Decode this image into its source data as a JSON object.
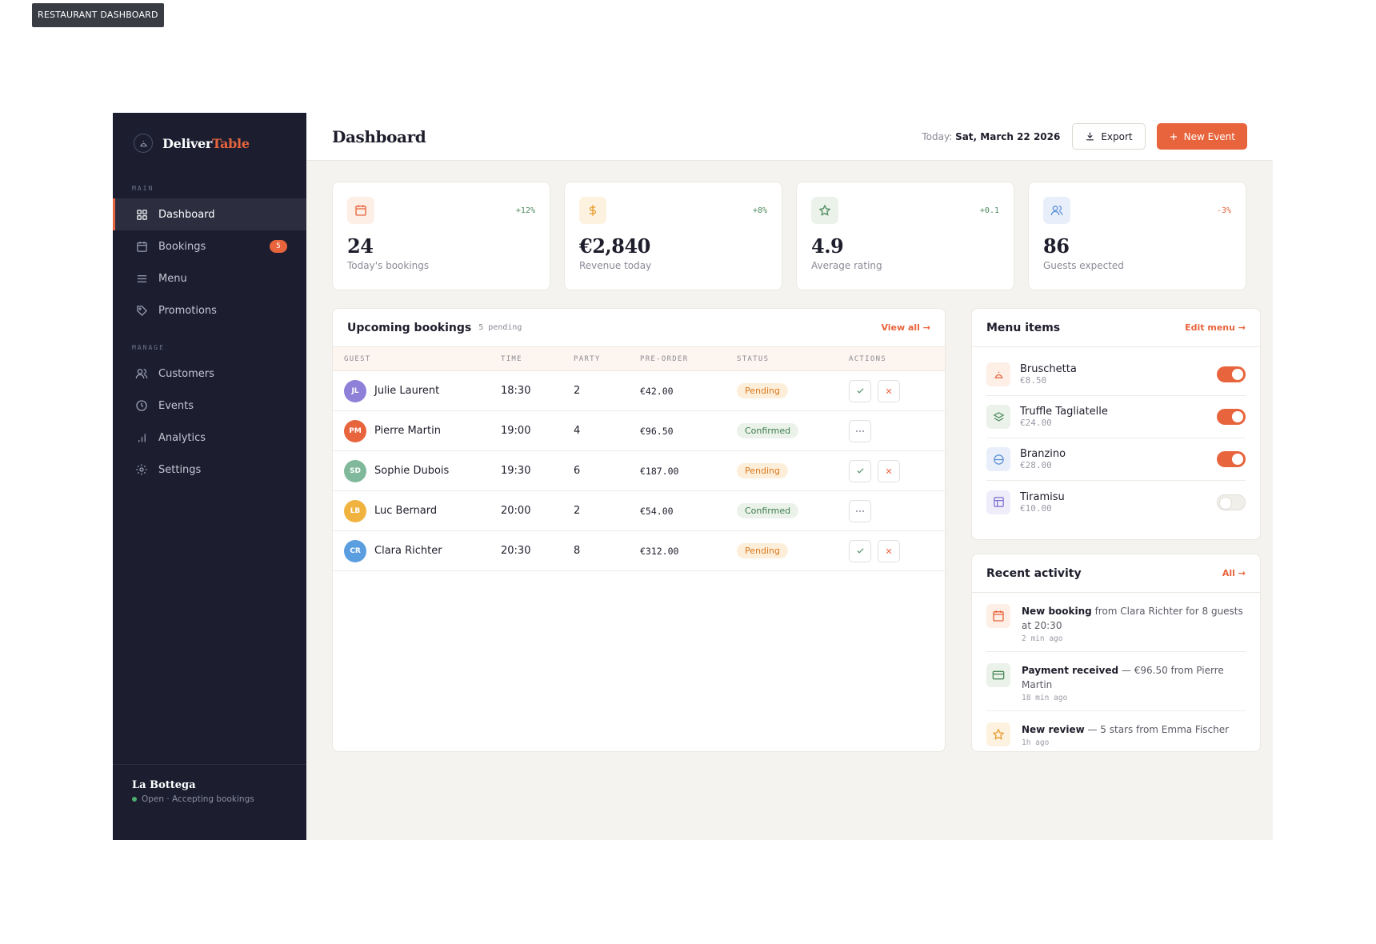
{
  "top_tag": "RESTAURANT DASHBOARD",
  "brand": {
    "name_a": "Deliver",
    "name_b": "Table"
  },
  "sidebar": {
    "section_main": "MAIN",
    "section_manage": "MANAGE",
    "items": [
      {
        "label": "Dashboard",
        "icon": "grid-icon"
      },
      {
        "label": "Bookings",
        "icon": "calendar-icon",
        "badge": "5"
      },
      {
        "label": "Menu",
        "icon": "menu-lines-icon"
      },
      {
        "label": "Promotions",
        "icon": "tag-icon"
      },
      {
        "label": "Customers",
        "icon": "users-icon"
      },
      {
        "label": "Events",
        "icon": "clock-icon"
      },
      {
        "label": "Analytics",
        "icon": "bar-chart-icon"
      },
      {
        "label": "Settings",
        "icon": "settings-icon"
      }
    ],
    "footer": {
      "name": "La Bottega",
      "status": "Open · Accepting bookings"
    }
  },
  "header": {
    "title": "Dashboard",
    "today_label": "Today:",
    "today_date": "Sat, March 22 2026",
    "export_label": "Export",
    "new_event_label": "New Event"
  },
  "stats": [
    {
      "value": "24",
      "label": "Today's bookings",
      "delta": "+12%",
      "icon": "calendar-icon",
      "color": "#e8643c",
      "bg": "#fdeee6"
    },
    {
      "value": "€2,840",
      "label": "Revenue today",
      "delta": "+8%",
      "icon": "dollar-icon",
      "color": "#e89a2c",
      "bg": "#fdf2df"
    },
    {
      "value": "4.9",
      "label": "Average rating",
      "delta": "+0.1",
      "icon": "star-icon",
      "color": "#4d8a5c",
      "bg": "#eaf2ea"
    },
    {
      "value": "86",
      "label": "Guests expected",
      "delta": "-3%",
      "icon": "users-icon",
      "color": "#5b8fd6",
      "bg": "#e8effa"
    }
  ],
  "bookings": {
    "title": "Upcoming bookings",
    "sub": "5 pending",
    "view_all": "View all →",
    "columns": [
      "GUEST",
      "TIME",
      "PARTY",
      "PRE-ORDER",
      "STATUS",
      "ACTIONS"
    ],
    "rows": [
      {
        "initials": "JL",
        "name": "Julie Laurent",
        "time": "18:30",
        "party": "2",
        "preorder": "€42.00",
        "status": "Pending",
        "avatar": "#8e7fd8"
      },
      {
        "initials": "PM",
        "name": "Pierre Martin",
        "time": "19:00",
        "party": "4",
        "preorder": "€96.50",
        "status": "Confirmed",
        "avatar": "#e8643c"
      },
      {
        "initials": "SD",
        "name": "Sophie Dubois",
        "time": "19:30",
        "party": "6",
        "preorder": "€187.00",
        "status": "Pending",
        "avatar": "#7fb89a"
      },
      {
        "initials": "LB",
        "name": "Luc Bernard",
        "time": "20:00",
        "party": "2",
        "preorder": "€54.00",
        "status": "Confirmed",
        "avatar": "#f0b340"
      },
      {
        "initials": "CR",
        "name": "Clara Richter",
        "time": "20:30",
        "party": "8",
        "preorder": "€312.00",
        "status": "Pending",
        "avatar": "#5b9ee0"
      }
    ]
  },
  "menu_items": {
    "title": "Menu items",
    "edit": "Edit menu →",
    "items": [
      {
        "name": "Bruschetta",
        "price": "€8.50",
        "on": true,
        "icon": "bell-icon",
        "color": "#e8643c",
        "bg": "#fdeee6"
      },
      {
        "name": "Truffle Tagliatelle",
        "price": "€24.00",
        "on": true,
        "icon": "layers-icon",
        "color": "#4d8a5c",
        "bg": "#eaf2ea"
      },
      {
        "name": "Branzino",
        "price": "€28.00",
        "on": true,
        "icon": "fish-icon",
        "color": "#5b8fd6",
        "bg": "#e8effa"
      },
      {
        "name": "Tiramisu",
        "price": "€10.00",
        "on": false,
        "icon": "cake-icon",
        "color": "#7a6fd0",
        "bg": "#efedfa"
      }
    ]
  },
  "activity": {
    "title": "Recent activity",
    "all": "All →",
    "items": [
      {
        "bold": "New booking",
        "rest": " from Clara Richter for 8 guests at 20:30",
        "time": "2 min ago",
        "icon": "calendar-icon",
        "color": "#e8643c",
        "bg": "#fdeee6"
      },
      {
        "bold": "Payment received",
        "rest": " — €96.50 from Pierre Martin",
        "time": "18 min ago",
        "icon": "card-icon",
        "color": "#4d8a5c",
        "bg": "#eaf2ea"
      },
      {
        "bold": "New review",
        "rest": " — 5 stars from Emma Fischer",
        "time": "1h ago",
        "icon": "star-icon",
        "color": "#e89a2c",
        "bg": "#fdf2df"
      }
    ]
  }
}
